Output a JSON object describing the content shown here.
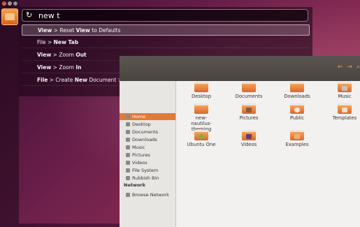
{
  "window_controls": [
    "×",
    "–",
    "□"
  ],
  "search": {
    "query": "new t"
  },
  "results": [
    {
      "pre": "View",
      "sep": " > Reset ",
      "bold": "View",
      "post": " to Defaults"
    },
    {
      "pre": "File",
      "sep": " > ",
      "bold": "New Tab",
      "post": ""
    },
    {
      "pre": "View",
      "sep": " > Zoom ",
      "bold": "Out",
      "post": ""
    },
    {
      "pre": "View",
      "sep": " > Zoom ",
      "bold": "In",
      "post": ""
    },
    {
      "pre": "File",
      "sep": " > Create ",
      "bold": "New",
      "post": " Document > Empty Document"
    }
  ],
  "sidebar": {
    "items": [
      "Home",
      "Desktop",
      "Documents",
      "Downloads",
      "Music",
      "Pictures",
      "Videos",
      "File System",
      "Rubbish Bin"
    ],
    "network_heading": "Network",
    "network_items": [
      "Browse Network"
    ]
  },
  "files": [
    {
      "name": "Desktop",
      "emblem": "none"
    },
    {
      "name": "Documents",
      "emblem": "none"
    },
    {
      "name": "Downloads",
      "emblem": "none"
    },
    {
      "name": "Music",
      "emblem": "music"
    },
    {
      "name": "new-nautilus-theming",
      "emblem": "none"
    },
    {
      "name": "Pictures",
      "emblem": "pictures"
    },
    {
      "name": "Public",
      "emblem": "person"
    },
    {
      "name": "Templates",
      "emblem": "templates"
    },
    {
      "name": "Ubuntu One",
      "emblem": "check"
    },
    {
      "name": "Videos",
      "emblem": "video"
    },
    {
      "name": "Examples",
      "emblem": "examples"
    }
  ],
  "colors": {
    "accent": "#e07a3a",
    "folder": "#e8853b"
  }
}
